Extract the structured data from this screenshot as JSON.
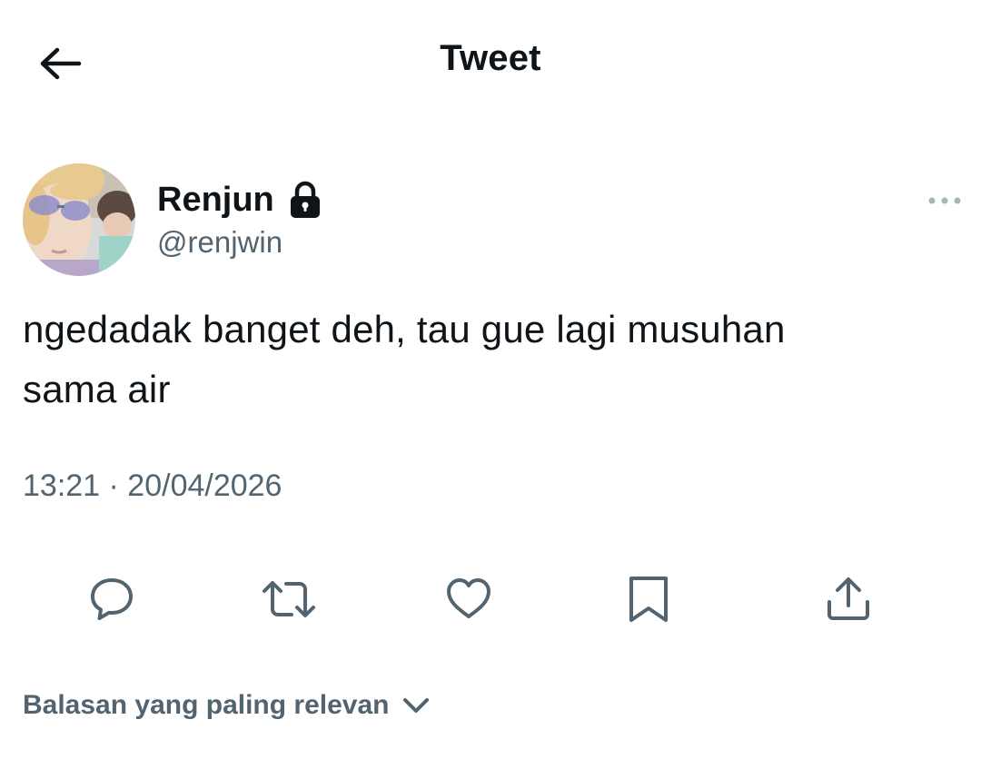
{
  "header": {
    "title": "Tweet",
    "back_icon": "arrow-left-icon"
  },
  "author": {
    "display_name": "Renjun",
    "handle": "@renjwin",
    "protected_icon": "lock-icon",
    "avatar": "profile-photo"
  },
  "tweet": {
    "text_line1": "ngedadak banget deh, tau gue lagi musuhan",
    "text_line2": "sama air",
    "timestamp": "13:21 · 20/04/2026"
  },
  "actions": [
    {
      "name": "reply",
      "icon": "reply-icon"
    },
    {
      "name": "retweet",
      "icon": "retweet-icon"
    },
    {
      "name": "like",
      "icon": "heart-icon"
    },
    {
      "name": "bookmark",
      "icon": "bookmark-icon"
    },
    {
      "name": "share",
      "icon": "share-icon"
    }
  ],
  "replies": {
    "sort_label": "Balasan yang paling relevan",
    "sort_icon": "chevron-down-icon"
  },
  "colors": {
    "text_primary": "#0f1419",
    "text_secondary": "#536471",
    "icon": "#536471",
    "background": "#ffffff"
  }
}
